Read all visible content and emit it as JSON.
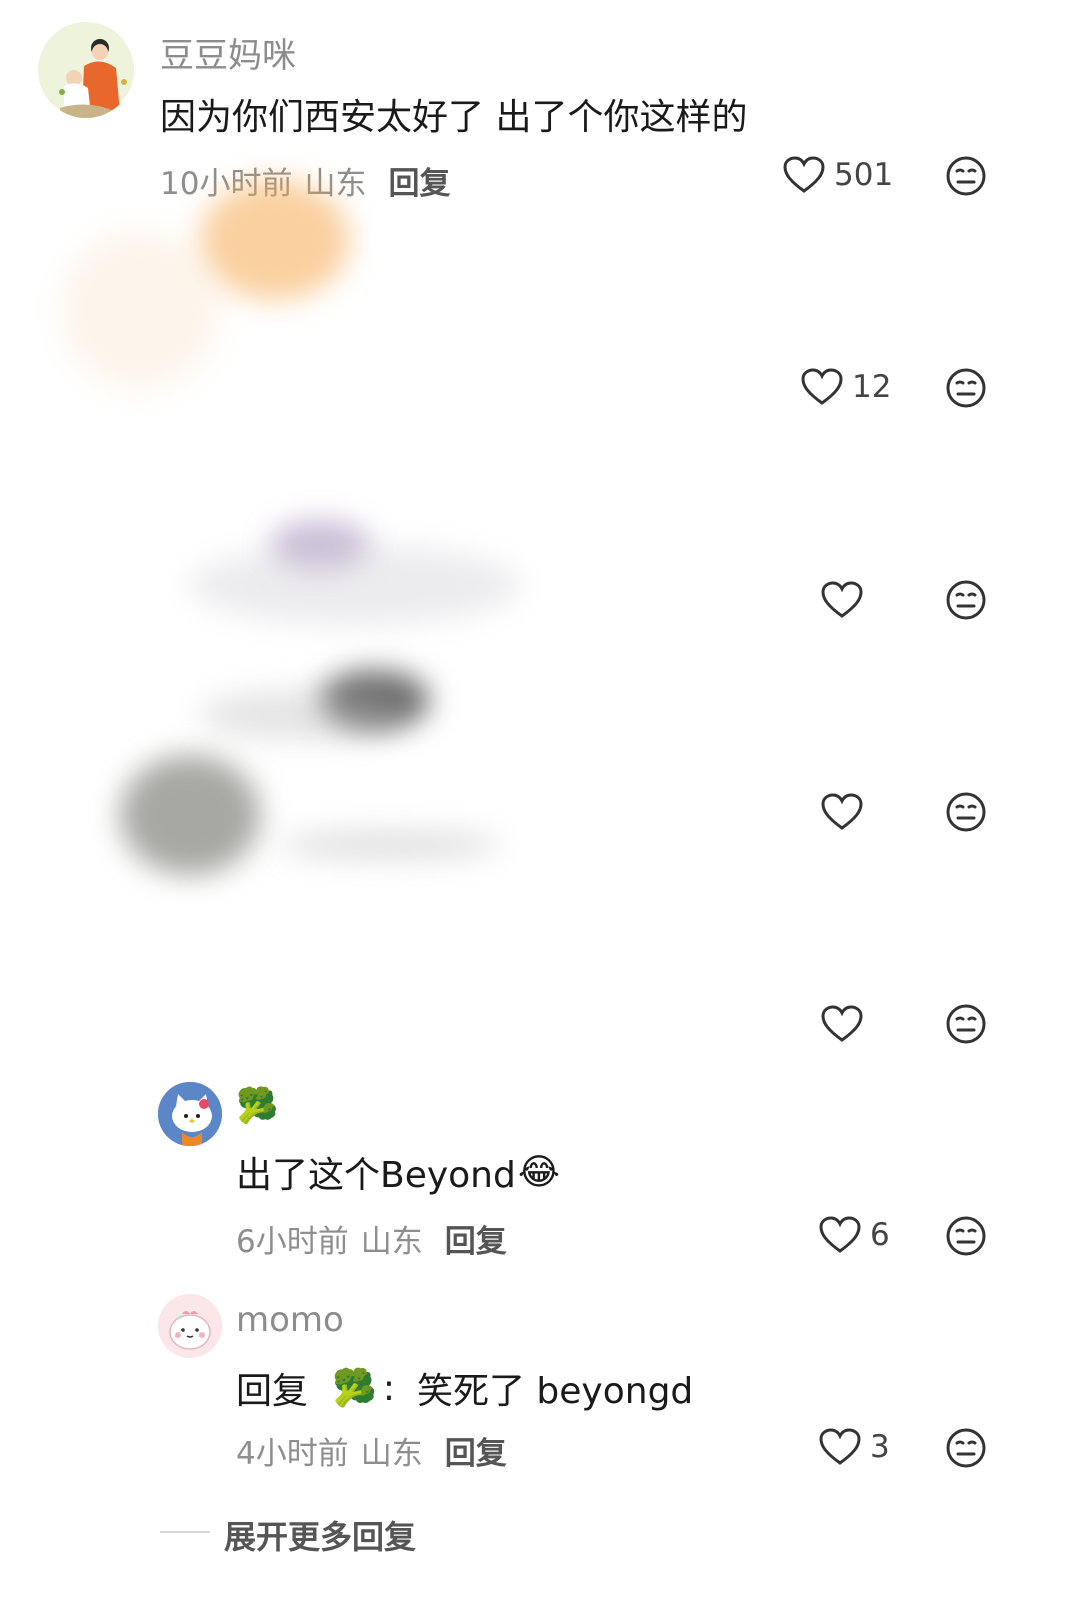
{
  "comments": [
    {
      "user": "豆豆妈咪",
      "text": "因为你们西安太好了 出了个你这样的",
      "time": "10小时前",
      "location": "山东",
      "reply_label": "回复",
      "likes": "501"
    }
  ],
  "hidden_rows": [
    {
      "likes": "12"
    },
    {
      "likes": ""
    },
    {
      "likes": ""
    },
    {
      "likes": ""
    }
  ],
  "replies": [
    {
      "user": "🥦",
      "text": "出了这个Beyond",
      "emoji": "😂",
      "time": "6小时前",
      "location": "山东",
      "reply_label": "回复",
      "likes": "6"
    },
    {
      "user": "momo",
      "reply_prefix": "回复",
      "reply_to": "🥦",
      "reply_sep": ":",
      "text": "笑死了 beyongd",
      "time": "4小时前",
      "location": "山东",
      "reply_label": "回复",
      "likes": "3"
    }
  ],
  "expand_more": "展开更多回复",
  "icons": {
    "like": "heart-outline-icon",
    "dislike": "neutral-face-icon"
  },
  "colors": {
    "text": "#1a1a1a",
    "meta": "#8e8e8e",
    "icon": "#333333"
  }
}
